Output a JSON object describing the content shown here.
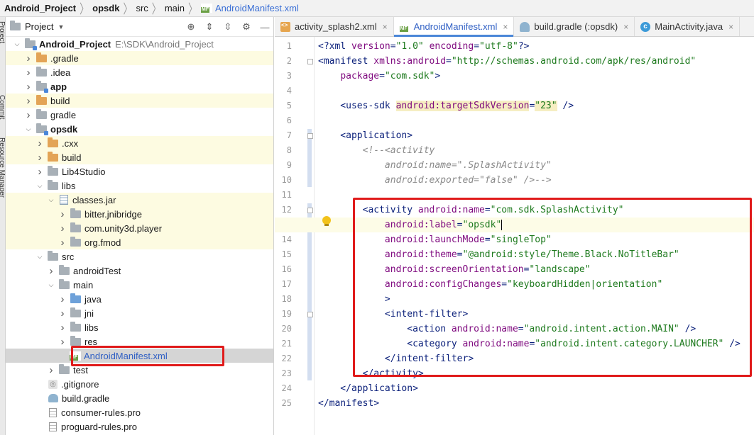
{
  "breadcrumb": [
    {
      "label": "Android_Project",
      "bold": true
    },
    {
      "label": "opsdk",
      "bold": true
    },
    {
      "label": "src",
      "bold": false
    },
    {
      "label": "main",
      "bold": false
    },
    {
      "label": "AndroidManifest.xml",
      "bold": false,
      "file": true
    }
  ],
  "side_tabs": [
    "Project",
    "Commit",
    "Resource Manager"
  ],
  "project_panel": {
    "title": "Project",
    "tree": [
      {
        "label": "Android_Project",
        "path": "E:\\SDK\\Android_Project",
        "icon": "folder-module-icon",
        "chev": "open",
        "bold": true,
        "hl": false
      },
      {
        "label": ".gradle",
        "icon": "folder-orange-icon",
        "chev": "closed",
        "hl": true
      },
      {
        "label": ".idea",
        "icon": "folder-icon",
        "chev": "closed",
        "hl": false
      },
      {
        "label": "app",
        "icon": "folder-module-icon",
        "chev": "closed",
        "bold": true,
        "hl": false
      },
      {
        "label": "build",
        "icon": "folder-orange-icon",
        "chev": "closed",
        "hl": true
      },
      {
        "label": "gradle",
        "icon": "folder-icon",
        "chev": "closed",
        "hl": false
      },
      {
        "label": "opsdk",
        "icon": "folder-module-icon",
        "chev": "open",
        "bold": true,
        "hl": false
      },
      {
        "label": ".cxx",
        "icon": "folder-orange-icon",
        "chev": "closed",
        "hl": true
      },
      {
        "label": "build",
        "icon": "folder-orange-icon",
        "chev": "closed",
        "hl": true
      },
      {
        "label": "Lib4Studio",
        "icon": "folder-icon",
        "chev": "closed",
        "hl": false
      },
      {
        "label": "libs",
        "icon": "folder-icon",
        "chev": "open",
        "hl": false
      },
      {
        "label": "classes.jar",
        "icon": "jar-icon",
        "chev": "open",
        "hl": true
      },
      {
        "label": "bitter.jnibridge",
        "icon": "package-icon",
        "chev": "closed",
        "hl": true
      },
      {
        "label": "com.unity3d.player",
        "icon": "package-icon",
        "chev": "closed",
        "hl": true
      },
      {
        "label": "org.fmod",
        "icon": "package-icon",
        "chev": "closed",
        "hl": true
      },
      {
        "label": "src",
        "icon": "folder-icon",
        "chev": "open",
        "hl": false
      },
      {
        "label": "androidTest",
        "icon": "folder-icon",
        "chev": "closed",
        "hl": false
      },
      {
        "label": "main",
        "icon": "folder-icon",
        "chev": "open",
        "hl": false
      },
      {
        "label": "java",
        "icon": "folder-source-icon",
        "chev": "closed",
        "hl": false
      },
      {
        "label": "jni",
        "icon": "folder-icon",
        "chev": "closed",
        "hl": false
      },
      {
        "label": "libs",
        "icon": "folder-icon",
        "chev": "closed",
        "hl": false
      },
      {
        "label": "res",
        "icon": "folder-resource-icon",
        "chev": "closed",
        "hl": false
      },
      {
        "label": "AndroidManifest.xml",
        "icon": "manifest-file-icon",
        "chev": "none",
        "hl": false,
        "selected": true
      },
      {
        "label": "test",
        "icon": "folder-icon",
        "chev": "closed",
        "hl": false
      },
      {
        "label": ".gitignore",
        "icon": "gitignore-file-icon",
        "chev": "none",
        "hl": false
      },
      {
        "label": "build.gradle",
        "icon": "gradle-file-icon",
        "chev": "none",
        "hl": false
      },
      {
        "label": "consumer-rules.pro",
        "icon": "text-file-icon",
        "chev": "none",
        "hl": false
      },
      {
        "label": "proguard-rules.pro",
        "icon": "text-file-icon",
        "chev": "none",
        "hl": false
      }
    ]
  },
  "tabs": [
    {
      "label": "activity_splash2.xml",
      "icon": "xml-icon",
      "active": false
    },
    {
      "label": "AndroidManifest.xml",
      "icon": "manifest-icon",
      "active": true
    },
    {
      "label": "build.gradle (:opsdk)",
      "icon": "gradle-icon",
      "active": false
    },
    {
      "label": "MainActivity.java",
      "icon": "class-icon",
      "active": false
    }
  ],
  "close_glyph": "×",
  "code_lines": [
    [
      [
        "b",
        "<?"
      ],
      [
        "t",
        "xml "
      ],
      [
        "a",
        "version"
      ],
      [
        "b",
        "="
      ],
      [
        "v",
        "\"1.0\""
      ],
      [
        "b",
        " "
      ],
      [
        "a",
        "encoding"
      ],
      [
        "b",
        "="
      ],
      [
        "v",
        "\"utf-8\""
      ],
      [
        "b",
        "?>"
      ]
    ],
    [
      [
        "b",
        "<"
      ],
      [
        "t",
        "manifest "
      ],
      [
        "a",
        "xmlns:android"
      ],
      [
        "b",
        "="
      ],
      [
        "v",
        "\"http://schemas.android.com/apk/res/android\""
      ]
    ],
    [
      [
        "b",
        "    "
      ],
      [
        "a",
        "package"
      ],
      [
        "b",
        "="
      ],
      [
        "v",
        "\"com.sdk\""
      ],
      [
        "b",
        ">"
      ]
    ],
    [],
    [
      [
        "b",
        "    <"
      ],
      [
        "t",
        "uses-sdk "
      ],
      [
        "ah",
        "android:targetSdkVersion"
      ],
      [
        "b",
        "="
      ],
      [
        "vh",
        "\"23\""
      ],
      [
        "b",
        " />"
      ]
    ],
    [],
    [
      [
        "b",
        "    <"
      ],
      [
        "t",
        "application"
      ],
      [
        "b",
        ">"
      ]
    ],
    [
      [
        "c",
        "        <!--<activity"
      ]
    ],
    [
      [
        "c",
        "            android:name=\".SplashActivity\""
      ]
    ],
    [
      [
        "c",
        "            android:exported=\"false\" />-->"
      ]
    ],
    [],
    [
      [
        "b",
        "        <"
      ],
      [
        "t",
        "activity "
      ],
      [
        "a",
        "android:name"
      ],
      [
        "b",
        "="
      ],
      [
        "v",
        "\"com.sdk.SplashActivity\""
      ]
    ],
    [
      [
        "b",
        "            "
      ],
      [
        "a",
        "android:label"
      ],
      [
        "b",
        "="
      ],
      [
        "v",
        "\"opsdk\""
      ]
    ],
    [
      [
        "b",
        "            "
      ],
      [
        "a",
        "android:launchMode"
      ],
      [
        "b",
        "="
      ],
      [
        "v",
        "\"singleTop\""
      ]
    ],
    [
      [
        "b",
        "            "
      ],
      [
        "a",
        "android:theme"
      ],
      [
        "b",
        "="
      ],
      [
        "v",
        "\"@android:style/Theme.Black.NoTitleBar\""
      ]
    ],
    [
      [
        "b",
        "            "
      ],
      [
        "a",
        "android:screenOrientation"
      ],
      [
        "b",
        "="
      ],
      [
        "v",
        "\"landscape\""
      ]
    ],
    [
      [
        "b",
        "            "
      ],
      [
        "a",
        "android:configChanges"
      ],
      [
        "b",
        "="
      ],
      [
        "v",
        "\"keyboardHidden|orientation\""
      ]
    ],
    [
      [
        "b",
        "            >"
      ]
    ],
    [
      [
        "b",
        "            <"
      ],
      [
        "t",
        "intent-filter"
      ],
      [
        "b",
        ">"
      ]
    ],
    [
      [
        "b",
        "                <"
      ],
      [
        "t",
        "action "
      ],
      [
        "a",
        "android:name"
      ],
      [
        "b",
        "="
      ],
      [
        "v",
        "\"android.intent.action.MAIN\""
      ],
      [
        "b",
        " />"
      ]
    ],
    [
      [
        "b",
        "                <"
      ],
      [
        "t",
        "category "
      ],
      [
        "a",
        "android:name"
      ],
      [
        "b",
        "="
      ],
      [
        "v",
        "\"android.intent.category.LAUNCHER\""
      ],
      [
        "b",
        " />"
      ]
    ],
    [
      [
        "b",
        "            </"
      ],
      [
        "t",
        "intent-filter"
      ],
      [
        "b",
        ">"
      ]
    ],
    [
      [
        "b",
        "        </"
      ],
      [
        "t",
        "activity"
      ],
      [
        "b",
        ">"
      ]
    ],
    [
      [
        "b",
        "    </"
      ],
      [
        "t",
        "application"
      ],
      [
        "b",
        ">"
      ]
    ],
    [
      [
        "b",
        "</"
      ],
      [
        "t",
        "manifest"
      ],
      [
        "b",
        ">"
      ]
    ]
  ],
  "current_line": 13
}
